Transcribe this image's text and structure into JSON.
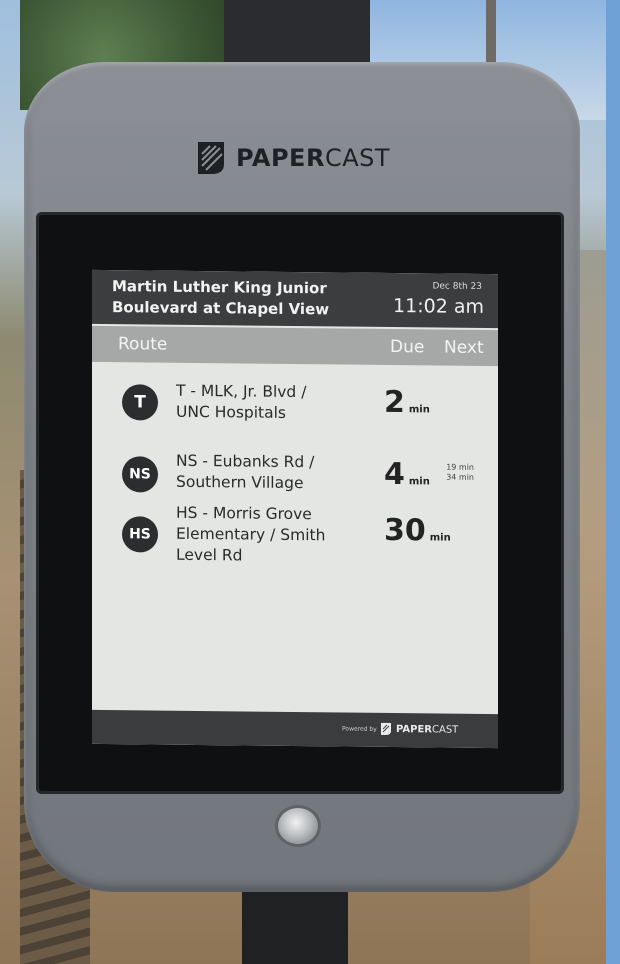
{
  "device": {
    "brand": {
      "bold": "PAPER",
      "light": "CAST"
    }
  },
  "stop": {
    "name": "Martin Luther King Junior\nBoulevard at Chapel View",
    "date": "Dec 8th 23",
    "time": "11:02 am"
  },
  "columns": {
    "route": "Route",
    "due": "Due",
    "next": "Next"
  },
  "routes": [
    {
      "badge": "T",
      "name": "T - MLK, Jr. Blvd /\nUNC Hospitals",
      "due": "2",
      "unit": "min",
      "next": [
        "",
        ""
      ]
    },
    {
      "badge": "NS",
      "name": "NS - Eubanks Rd /\nSouthern Village",
      "due": "4",
      "unit": "min",
      "next": [
        "19 min",
        "34 min"
      ]
    },
    {
      "badge": "HS",
      "name": "HS - Morris Grove\nElementary / Smith\nLevel Rd",
      "due": "30",
      "unit": "min",
      "next": [
        "",
        ""
      ]
    }
  ],
  "footer": {
    "powered_by": "Powered by",
    "logo_bold": "PAPER",
    "logo_light": "CAST"
  }
}
